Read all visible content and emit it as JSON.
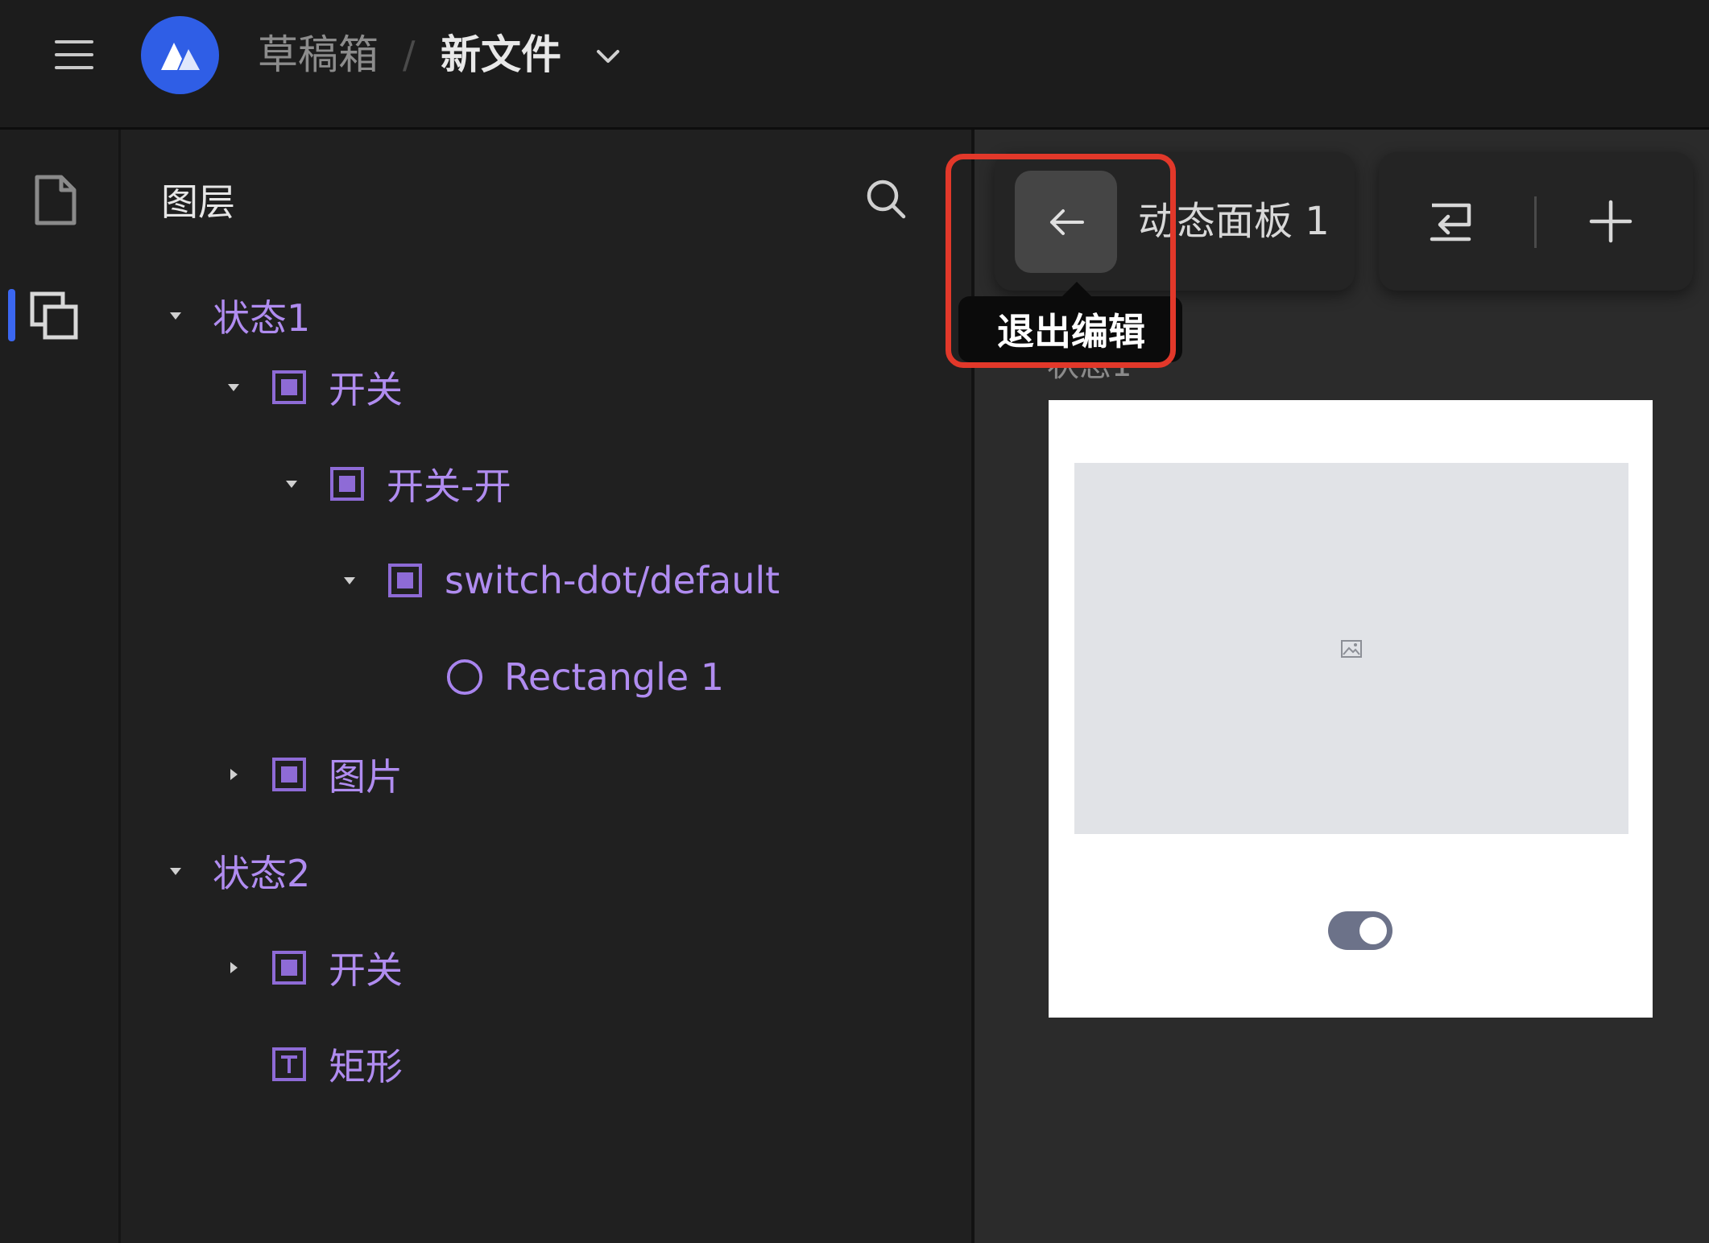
{
  "header": {
    "breadcrumb_root": "草稿箱",
    "breadcrumb_separator": "/",
    "file_name": "新文件",
    "logo_color": "#2f5ee6"
  },
  "rail": {
    "items": [
      {
        "name": "pages",
        "icon": "page-icon",
        "active": false
      },
      {
        "name": "layers",
        "icon": "layers-icon",
        "active": true
      }
    ]
  },
  "layers_panel": {
    "title": "图层",
    "items": [
      {
        "label": "状态1",
        "depth": 0,
        "caret": "down",
        "icon": "none"
      },
      {
        "label": "开关",
        "depth": 1,
        "caret": "down",
        "icon": "frame-icon"
      },
      {
        "label": "开关-开",
        "depth": 2,
        "caret": "down",
        "icon": "frame-icon"
      },
      {
        "label": "switch-dot/default",
        "depth": 3,
        "caret": "down",
        "icon": "frame-icon"
      },
      {
        "label": "Rectangle 1",
        "depth": 4,
        "caret": "none",
        "icon": "ellipse-icon"
      },
      {
        "label": "图片",
        "depth": 1,
        "caret": "right",
        "icon": "frame-icon"
      },
      {
        "label": "状态2",
        "depth": 0,
        "caret": "down",
        "icon": "none"
      },
      {
        "label": "开关",
        "depth": 1,
        "caret": "right",
        "icon": "frame-icon"
      },
      {
        "label": "矩形",
        "depth": 1,
        "caret": "none",
        "icon": "text-icon"
      }
    ],
    "label_color": "#b08cf0"
  },
  "canvas": {
    "panel_title": "动态面板 1",
    "state_label": "状态1",
    "tooltip": "退出编辑",
    "highlight_color": "#e2382a",
    "toggle_on": true
  }
}
